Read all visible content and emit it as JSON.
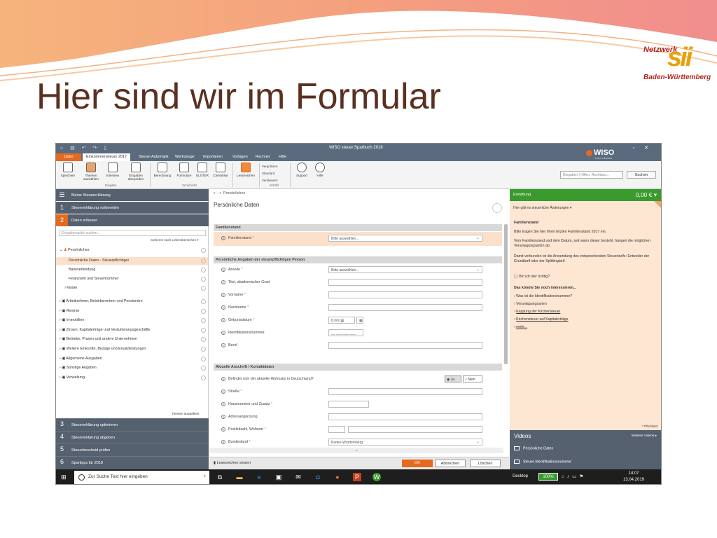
{
  "slide": {
    "title": "Hier sind wir im Formular",
    "logo_line1": "Netzwerk",
    "logo_mark": "sii",
    "logo_line2": "Baden-Württemberg"
  },
  "colors": {
    "accent": "#e36a1e",
    "header": "#5b6b7d",
    "sidebar": "#55616f",
    "green": "#3a9a2e",
    "highlight": "#fbe1cc",
    "title": "#5a3020"
  },
  "app": {
    "title": "WISO steuer:Sparbuch 2018",
    "menu": [
      "Datei",
      "Einkommensteuer 2017",
      "Steuer-Automatik",
      "Werkzeuge",
      "Importieren",
      "Vorlagen",
      "Rechner",
      "Hilfe"
    ],
    "logo": "WISO",
    "logo_sub": "SOFTWARE",
    "ribbon": {
      "speichern": "Speichern",
      "themen": "Themen auswählen",
      "interview": "Interview",
      "eingaben": "Eingaben überprüfen",
      "berechnung": "Berechnung",
      "formulare": "Formulare",
      "elster": "ELSTER",
      "checkliste": "Checkliste",
      "lesezeichen": "Lesezeichen",
      "vergroessern": "Vergrößern",
      "standard": "Standard",
      "verkleinern": "Verkleinern",
      "support": "Support",
      "hilfe": "Hilfe",
      "grp_eingabe": "Eingabe",
      "grp_vorschicht": "Vorschicht",
      "grp_schrift": "Schrift"
    },
    "search_placeholder": "Eingaben | Hilfen, Rechtspu...",
    "search_button": "Suchen"
  },
  "sidebar": {
    "meine": "Meine Steuererklärung",
    "step1": {
      "num": "1",
      "label": "Steuererklärung vorbereiten"
    },
    "step2": {
      "num": "2",
      "label": "Daten erfassen"
    },
    "search_placeholder": "Eingabemaske suchen...",
    "sort": "Sortieren nach Lebensbereichen ▾",
    "tree": {
      "persoenliches": "Persönliches",
      "pd": "Persönliche Daten - Steuerpflichtiger",
      "bank": "Bankverbindung",
      "finanzamt": "Finanzamt und Steuernummer",
      "kinder": "Kinder",
      "arbeit": "Arbeitnehmer, Betriebsrentner und Pensionäre",
      "rentner": "Rentner",
      "immobilien": "Immobilien",
      "zinsen": "Zinsen, Kapitalerträge und Veräußerungsgeschäfte",
      "betriebe": "Betriebe, Praxen und andere Unternehmen",
      "weitere": "Weitere Einkünfte, Bezüge und Ersatzleistungen",
      "allgemein": "Allgemeine Ausgaben",
      "sonstige": "Sonstige Angaben",
      "verwaltung": "Verwaltung"
    },
    "themen": "Themen auswählen",
    "bottom": [
      {
        "num": "3",
        "label": "Steuererklärung optimieren"
      },
      {
        "num": "4",
        "label": "Steuererklärung abgeben"
      },
      {
        "num": "5",
        "label": "Steuerbescheid prüfen"
      },
      {
        "num": "6",
        "label": "Spartipps für 2018"
      }
    ]
  },
  "main": {
    "breadcrumb": "Persönliches",
    "heading": "Persönliche Daten",
    "sec_familienstand": "Familienstand",
    "familienstand_label": "Familienstand",
    "familienstand_value": "Bitte auswählen...",
    "sec_angaben": "Persönliche Angaben der steuerpflichtigen Person",
    "anrede": "Anrede",
    "anrede_value": "Bitte auswählen...",
    "titel": "Titel, akademischer Grad",
    "vorname": "Vorname",
    "nachname": "Nachname",
    "geburtsdatum": "Geburtsdatum",
    "geburtsdatum_ph": "tt.mm.jjjj",
    "idnr": "Identifikationsnummer",
    "idnr_ph": "__ ___ ___ ___",
    "beruf": "Beruf",
    "sec_anschrift": "Aktuelle Anschrift / Kontaktdaten",
    "wohnsitz": "Befindet sich der aktuelle Wohnsitz in Deutschland?",
    "ja": "Ja",
    "nein": "Nein",
    "strasse": "Straße",
    "hausnummer": "Hausnummer und Zusatz",
    "adresserg": "Adressergänzung",
    "plz": "Postleitzahl, Wohnort",
    "bundesland": "Bundesland",
    "bundesland_value": "Baden-Württemberg",
    "bookmark": "Lesezeichen setzen",
    "ok": "OK",
    "abbrechen": "Abbrechen",
    "loeschen": "Löschen"
  },
  "right": {
    "label": "Erstattung",
    "value": "0,00 €",
    "sub": "Hier gibt es steuerliche Änderungen ▾",
    "h1": "Familienstand",
    "p1": "Bitte tragen Sie hier Ihren letzten Familienstand 2017 ein.",
    "p2": "Vom Familienstand und dem Datum, seit wann dieser besteht, hängen die möglichen Veranlagungsarten ab.",
    "p3": "Damit verbunden ist die Anwendung des entsprechenden Steuertarifs: Entweder der Grundtarif oder der Splittingtarif.",
    "hilfe": "Bin ich hier richtig?",
    "interest": "Das könnte Sie noch interessieren...",
    "links": [
      "Was ist die Identifikationsnummer?",
      "Veranlagungsarten",
      "Kappung der Kirchensteuer",
      "Kirchensteuer auf Kapitalerträge",
      "mehr..."
    ],
    "pflicht": "* Pflichtfeld",
    "videos": "Videos",
    "weitere_videos": "Weitere Videos ▸",
    "video1": "Persönliche Daten",
    "video2": "Steuer-Identifikationsnummer"
  },
  "taskbar": {
    "search": "Zur Suche Text hier eingeben",
    "desktop": "Desktop",
    "battery": "100%",
    "time": "14:07",
    "date": "13.04.2019"
  }
}
